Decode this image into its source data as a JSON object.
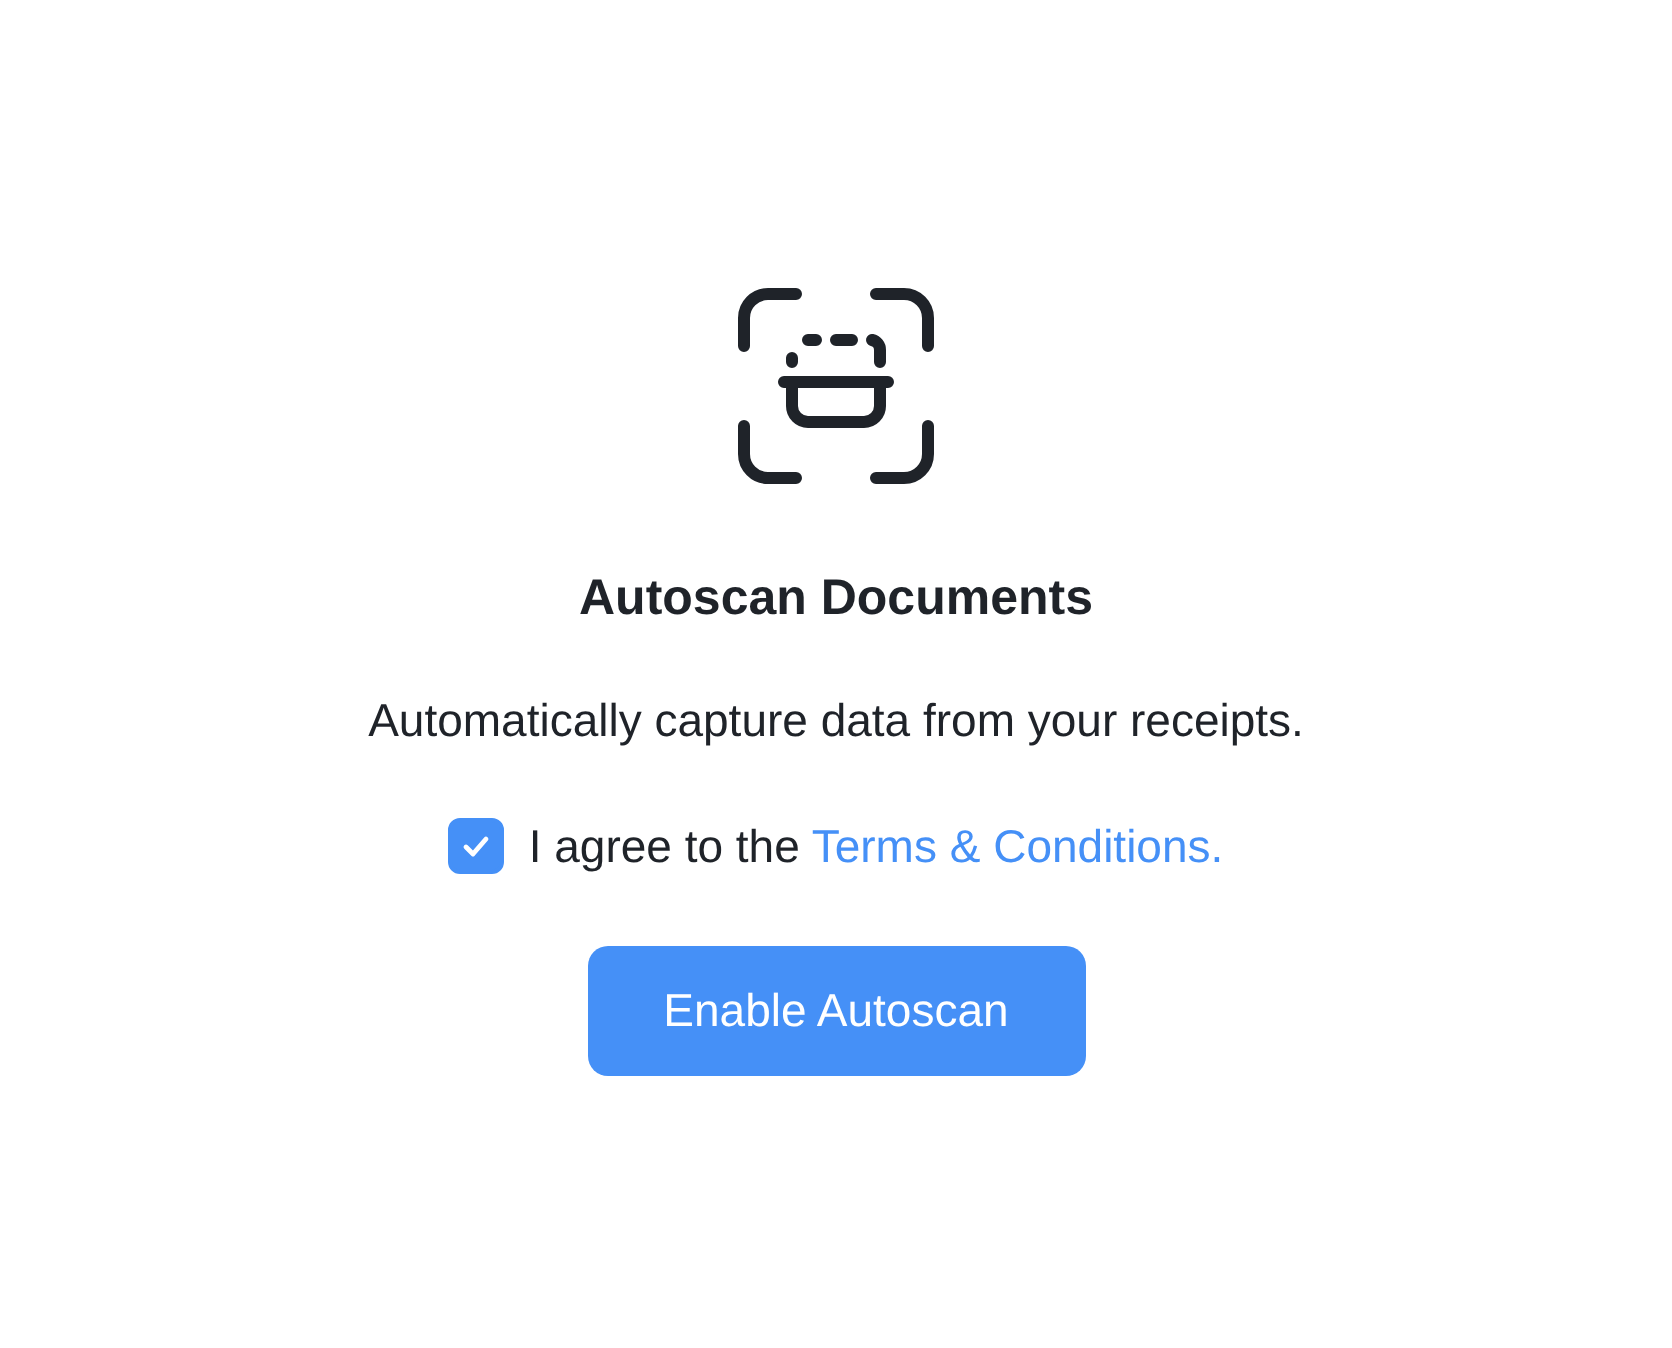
{
  "title": "Autoscan Documents",
  "description": "Automatically capture data from your receipts.",
  "agreement": {
    "checked": true,
    "text": "I agree to the",
    "link": "Terms & Conditions."
  },
  "button": {
    "label": "Enable Autoscan"
  }
}
